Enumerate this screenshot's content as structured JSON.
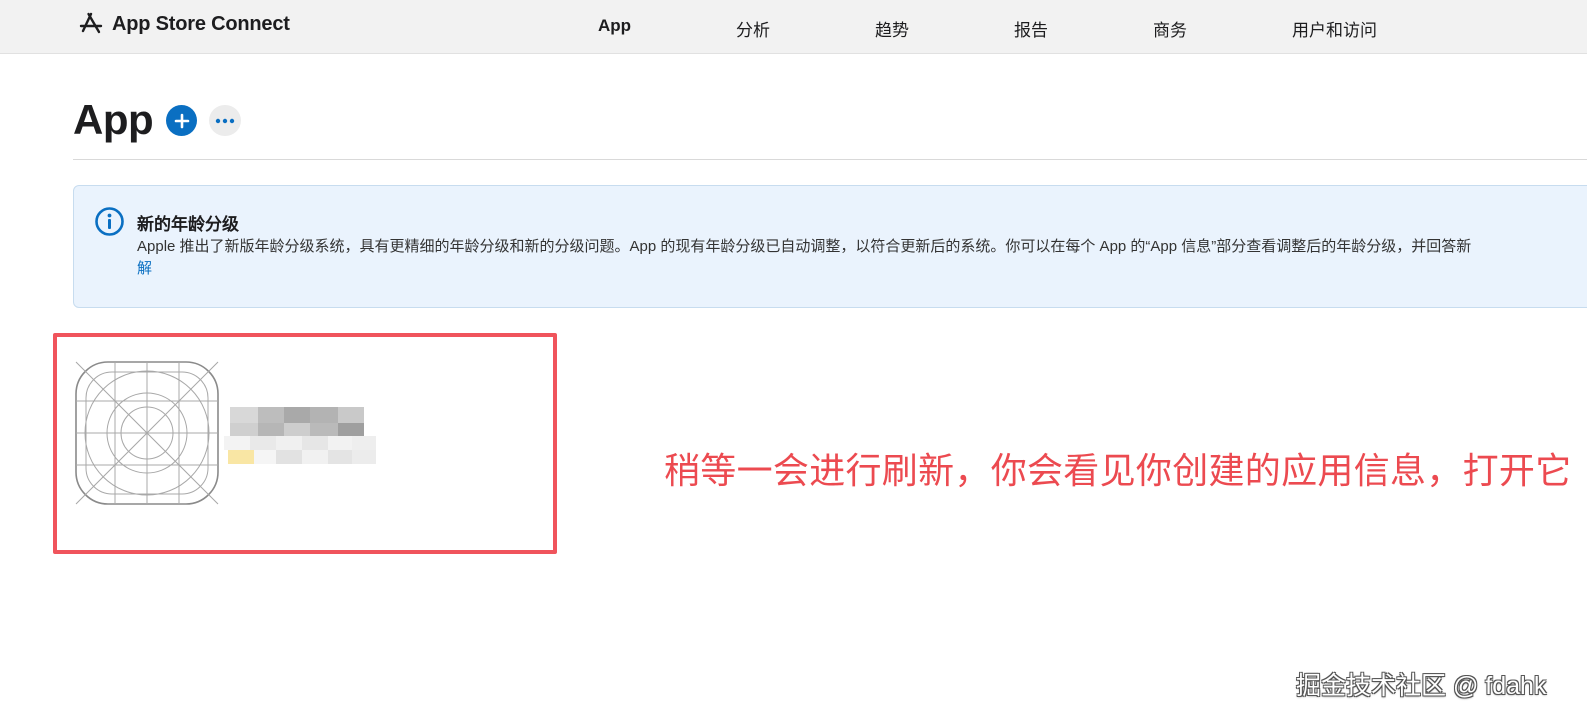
{
  "header": {
    "brand": "App Store Connect",
    "nav": [
      {
        "label": "App",
        "active": true
      },
      {
        "label": "分析",
        "active": false
      },
      {
        "label": "趋势",
        "active": false
      },
      {
        "label": "报告",
        "active": false
      },
      {
        "label": "商务",
        "active": false
      },
      {
        "label": "用户和访问",
        "active": false
      }
    ]
  },
  "page": {
    "title": "App"
  },
  "banner": {
    "title": "新的年龄分级",
    "body": "Apple 推出了新版年龄分级系统，具有更精细的年龄分级和新的分级问题。App 的现有年龄分级已自动调整，以符合更新后的系统。你可以在每个 App 的“App 信息”部分查看调整后的年龄分级，并回答新",
    "link": "解"
  },
  "annotation": "稍等一会进行刷新，你会看见你创建的应用信息，打开它",
  "watermark": "掘金技术社区 @ fdahk",
  "colors": {
    "accent": "#0a6fc2",
    "annotation": "#ec4a50",
    "banner_bg": "#eaf3fd"
  }
}
